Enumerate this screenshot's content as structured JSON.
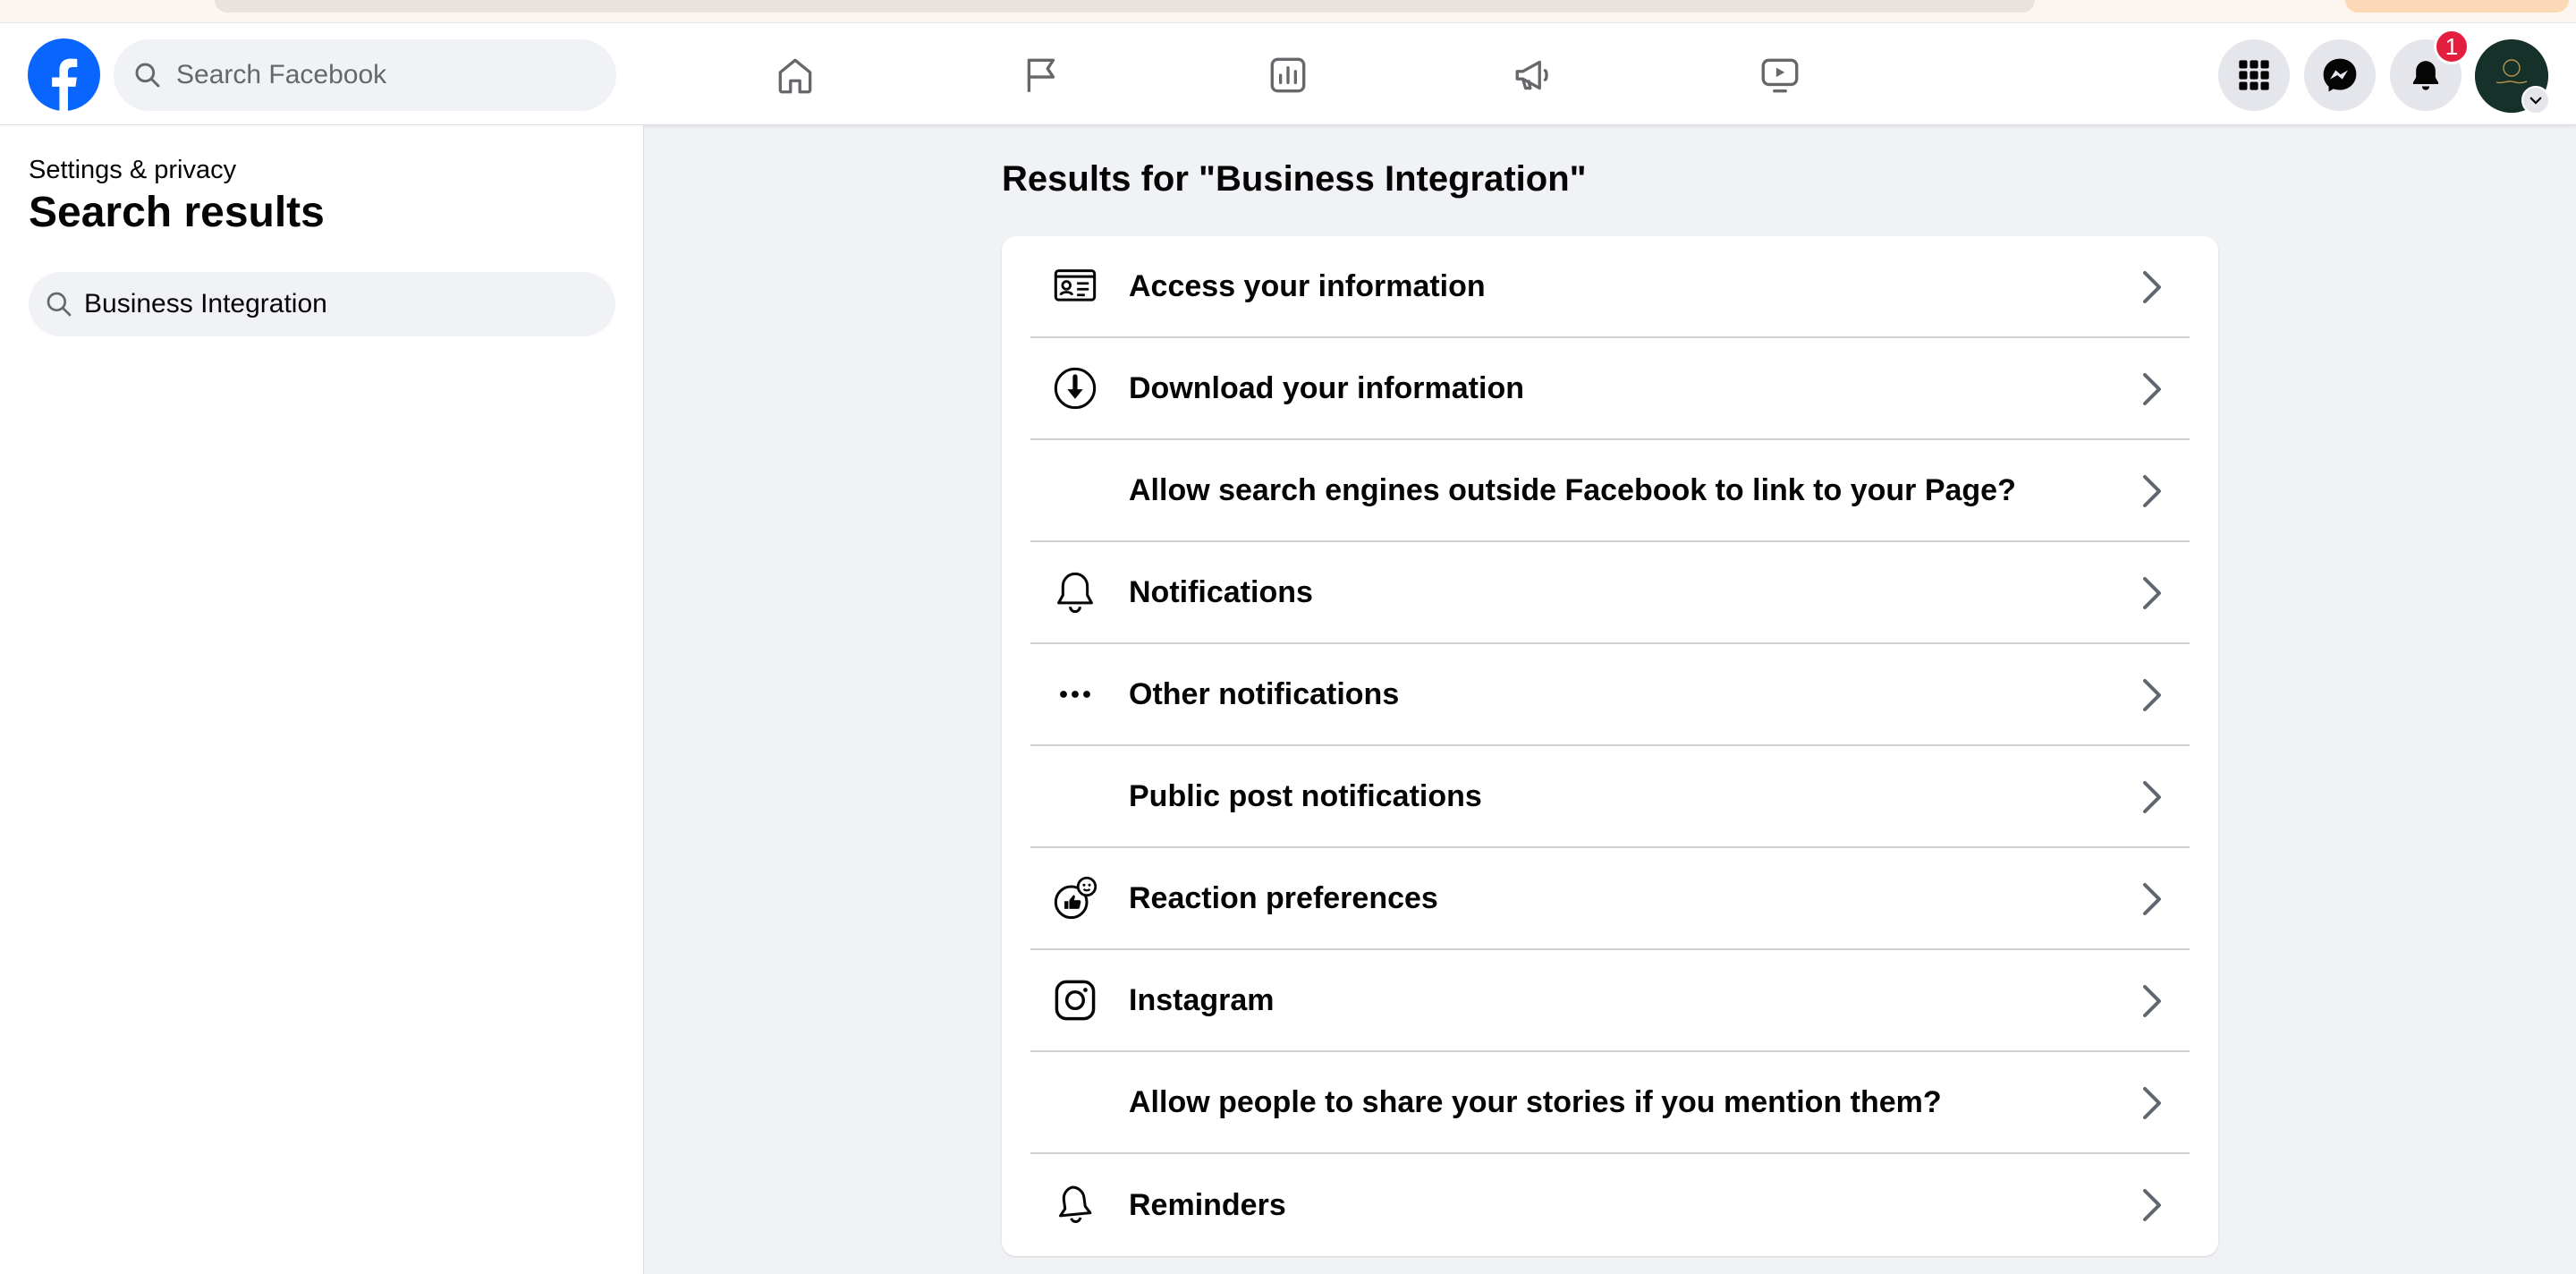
{
  "topbar": {
    "search_placeholder": "Search Facebook",
    "notification_count": "1",
    "accent_color": "#0866ff"
  },
  "nav": {
    "icons": [
      "home-icon",
      "flag-icon",
      "insights-icon",
      "megaphone-icon",
      "video-icon"
    ]
  },
  "right_icons": [
    "menu-grid-icon",
    "messenger-icon",
    "bell-icon",
    "avatar"
  ],
  "sidebar": {
    "breadcrumb": "Settings & privacy",
    "title": "Search results",
    "search_value": "Business Integration"
  },
  "main": {
    "heading": "Results for \"Business Integration\"",
    "results": [
      {
        "label": "Access your information",
        "icon": "id-card-icon"
      },
      {
        "label": "Download your information",
        "icon": "download-icon"
      },
      {
        "label": "Allow search engines outside Facebook to link to your Page?",
        "icon": ""
      },
      {
        "label": "Notifications",
        "icon": "bell-icon"
      },
      {
        "label": "Other notifications",
        "icon": "more-icon"
      },
      {
        "label": "Public post notifications",
        "icon": ""
      },
      {
        "label": "Reaction preferences",
        "icon": "reaction-icon"
      },
      {
        "label": "Instagram",
        "icon": "instagram-icon"
      },
      {
        "label": "Allow people to share your stories if you mention them?",
        "icon": ""
      },
      {
        "label": "Reminders",
        "icon": "reminder-bell-icon"
      }
    ]
  }
}
